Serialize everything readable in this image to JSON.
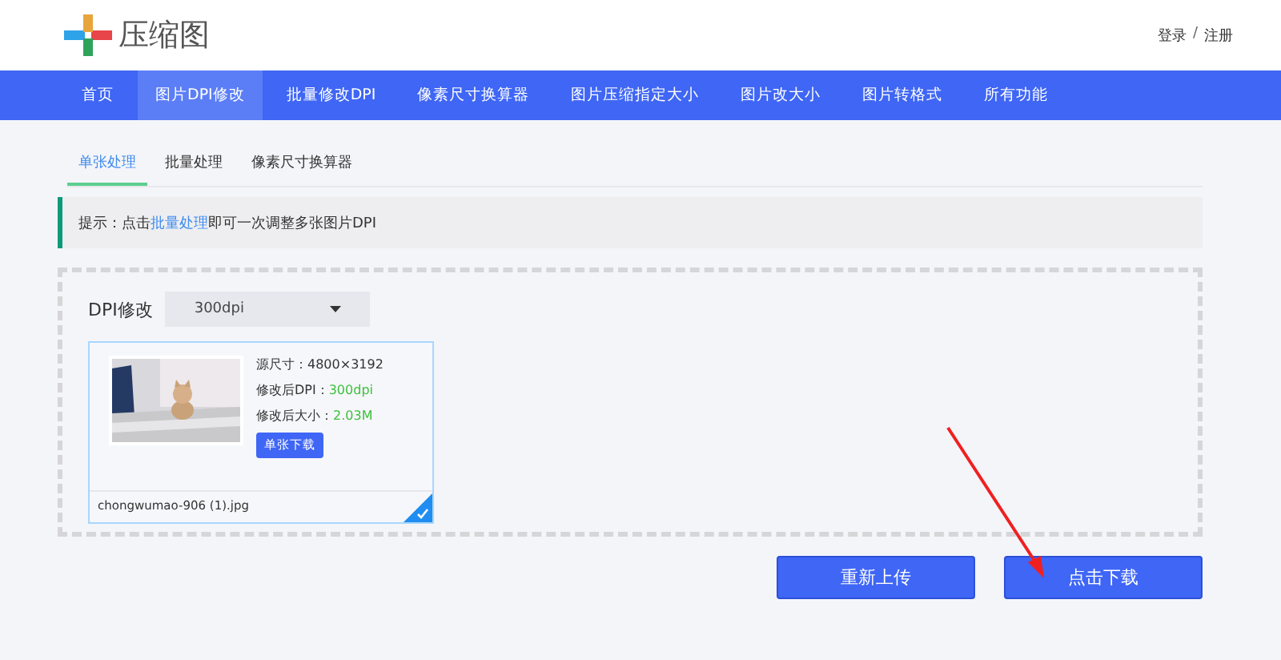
{
  "header": {
    "logo_text": "压缩图",
    "login": "登录",
    "separator": "/",
    "register": "注册"
  },
  "nav": [
    {
      "label": "首页",
      "selected": false
    },
    {
      "label": "图片DPI修改",
      "selected": true
    },
    {
      "label": "批量修改DPI",
      "selected": false
    },
    {
      "label": "像素尺寸换算器",
      "selected": false
    },
    {
      "label": "图片压缩指定大小",
      "selected": false
    },
    {
      "label": "图片改大小",
      "selected": false
    },
    {
      "label": "图片转格式",
      "selected": false
    },
    {
      "label": "所有功能",
      "selected": false
    }
  ],
  "tabs": [
    {
      "label": "单张处理",
      "selected": true
    },
    {
      "label": "批量处理",
      "selected": false
    },
    {
      "label": "像素尺寸换算器",
      "selected": false
    }
  ],
  "tip": {
    "prefix": "提示：点击",
    "link": "批量处理",
    "suffix": "即可一次调整多张图片DPI"
  },
  "dpi": {
    "label": "DPI修改",
    "value": "300dpi"
  },
  "file": {
    "kind": "picture",
    "source_size": "源尺寸：4800×3192",
    "dpi_label": "修改后DPI：",
    "dpi_value": "300dpi",
    "size_label": "修改后大小：",
    "size_value": "2.03M",
    "download": "单张下载",
    "name": "chongwumao-906 (1).jpg",
    "checked": true
  },
  "buttons": [
    {
      "label": "重新上传"
    },
    {
      "label": "点击下载"
    }
  ]
}
